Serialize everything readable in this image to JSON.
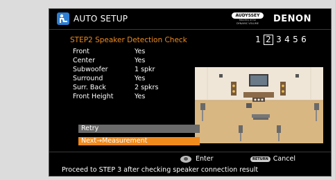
{
  "header": {
    "title": "AUTO SETUP",
    "brand": "DENON",
    "audyssey_badge": "AUDYSSEY",
    "audyssey_line1": "MULTEQ XT32",
    "audyssey_line2": "DYNAMIC VOLUME"
  },
  "step": {
    "title": "STEP2 Speaker Detection Check",
    "numbers": [
      "1",
      "2",
      "3",
      "4",
      "5",
      "6"
    ],
    "active_index": 1
  },
  "results": [
    {
      "label": "Front",
      "value": "Yes"
    },
    {
      "label": "Center",
      "value": "Yes"
    },
    {
      "label": "Subwoofer",
      "value": "1 spkr"
    },
    {
      "label": "Surround",
      "value": "Yes"
    },
    {
      "label": "Surr. Back",
      "value": "2 spkrs"
    },
    {
      "label": "Front Height",
      "value": "Yes"
    }
  ],
  "menu": {
    "retry": "Retry",
    "next": "Next→Measurement"
  },
  "footer": {
    "enter": "Enter",
    "return_key": "RETURN",
    "cancel": "Cancel",
    "guide": "Proceed to STEP 3 after checking speaker connection result"
  },
  "colors": {
    "accent": "#f08a1c",
    "background": "#000000",
    "retry_bg": "#6a6a6a",
    "icon_blue": "#2d7fd3"
  }
}
